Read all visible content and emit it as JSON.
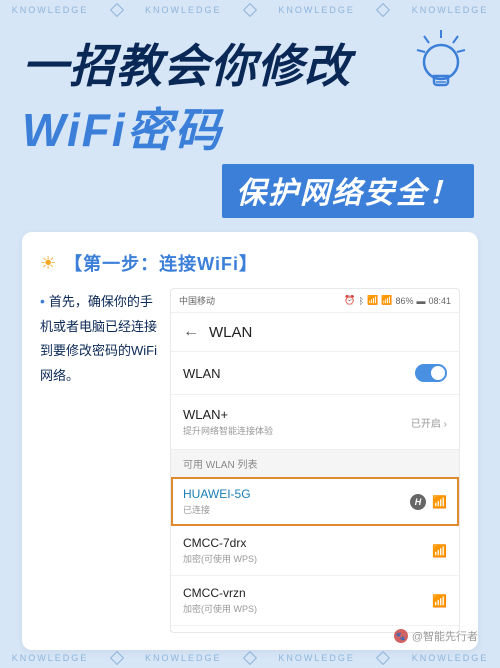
{
  "band_word": "KNOWLEDGE",
  "hero": {
    "line1": "一招教会你修改",
    "line2": "WiFi密码",
    "line3": "保护网络安全！"
  },
  "step": {
    "title": "【第一步：连接WiFi】",
    "desc": "首先，确保你的手机或者电脑已经连接到要修改密码的WiFi网络。"
  },
  "phone": {
    "carrier": "中国移动",
    "battery": "86%",
    "time": "08:41",
    "header": "WLAN",
    "wlan_label": "WLAN",
    "wlan_plus_title": "WLAN+",
    "wlan_plus_sub": "提升网络智能连接体验",
    "wlan_plus_status": "已开启",
    "list_header": "可用 WLAN 列表",
    "networks": [
      {
        "ssid": "HUAWEI-5G",
        "sub": "已连接",
        "selected": true,
        "badge": true
      },
      {
        "ssid": "CMCC-7drx",
        "sub": "加密(可使用 WPS)",
        "selected": false,
        "badge": false
      },
      {
        "ssid": "CMCC-vrzn",
        "sub": "加密(可使用 WPS)",
        "selected": false,
        "badge": false
      }
    ]
  },
  "watermark": "@智能先行者"
}
